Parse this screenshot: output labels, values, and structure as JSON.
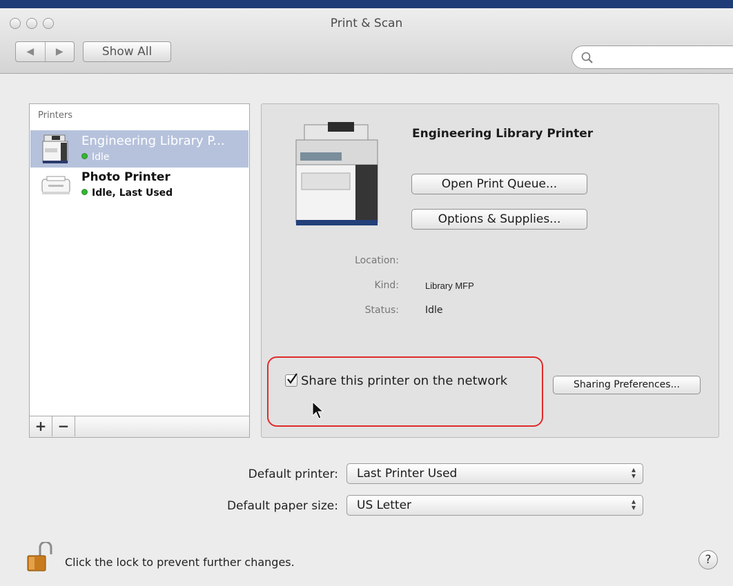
{
  "window": {
    "title": "Print & Scan"
  },
  "toolbar": {
    "back_icon": "◀",
    "forward_icon": "▶",
    "show_all_label": "Show All",
    "search_placeholder": "",
    "search_value": ""
  },
  "printers": {
    "header": "Printers",
    "items": [
      {
        "name": "Engineering Library P...",
        "status": "Idle",
        "icon": "mfp-printer-icon",
        "selected": true
      },
      {
        "name": "Photo Printer",
        "status": "Idle, Last Used",
        "icon": "photo-printer-icon",
        "selected": false
      }
    ],
    "add_label": "+",
    "remove_label": "−"
  },
  "details": {
    "printer_name": "Engineering Library Printer",
    "open_queue_label": "Open Print Queue...",
    "options_label": "Options & Supplies...",
    "location_label": "Location:",
    "location_value": "",
    "kind_label": "Kind:",
    "kind_value": "Library MFP",
    "status_label": "Status:",
    "status_value": "Idle",
    "share_checked": true,
    "share_label": "Share this printer on the network",
    "sharing_prefs_label": "Sharing Preferences..."
  },
  "defaults": {
    "printer_label": "Default printer:",
    "printer_value": "Last Printer Used",
    "paper_label": "Default paper size:",
    "paper_value": "US Letter"
  },
  "footer": {
    "lock_text": "Click the lock to prevent further changes.",
    "help_label": "?"
  },
  "colors": {
    "selection": "#b6c2dc",
    "highlight_border": "#e02a2a",
    "status_dot": "#35b535"
  }
}
